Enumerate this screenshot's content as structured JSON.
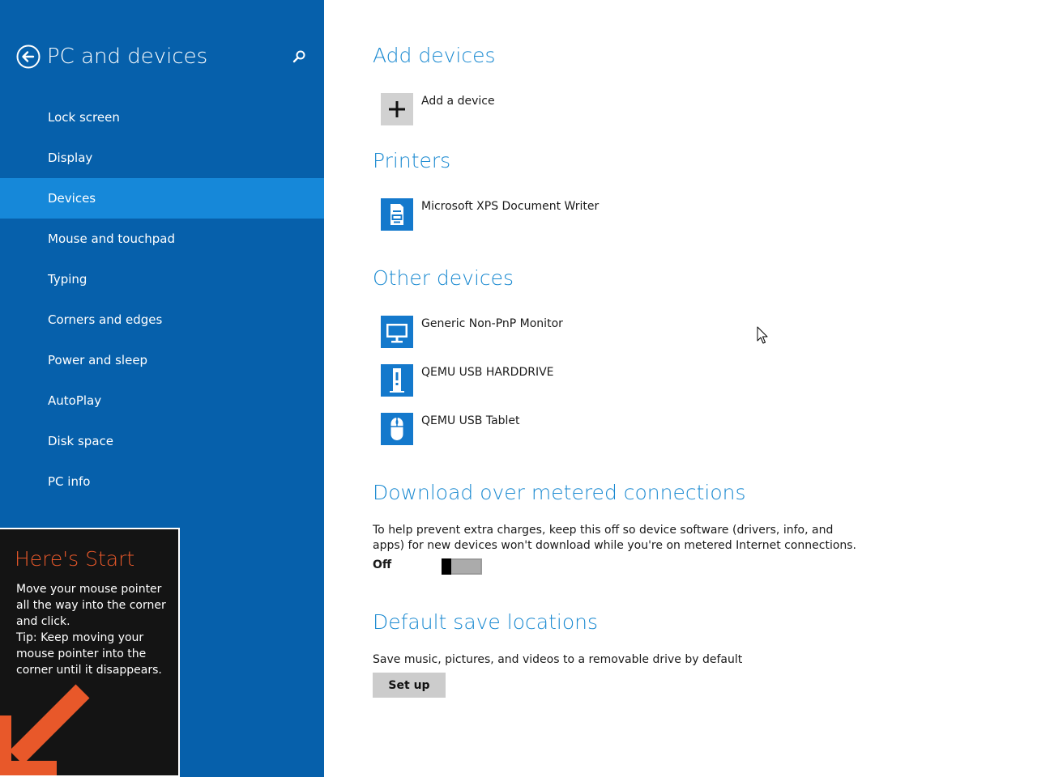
{
  "sidebar": {
    "title": "PC and devices",
    "items": [
      {
        "label": "Lock screen"
      },
      {
        "label": "Display"
      },
      {
        "label": "Devices",
        "selected": true
      },
      {
        "label": "Mouse and touchpad"
      },
      {
        "label": "Typing"
      },
      {
        "label": "Corners and edges"
      },
      {
        "label": "Power and sleep"
      },
      {
        "label": "AutoPlay"
      },
      {
        "label": "Disk space"
      },
      {
        "label": "PC info"
      }
    ]
  },
  "start_tip": {
    "title": "Here's Start",
    "body": "Move your mouse pointer all the way into the corner and click.\nTip: Keep moving your mouse pointer into the corner until it disappears."
  },
  "main": {
    "add_devices": {
      "title": "Add devices",
      "add_label": "Add a device",
      "icon": "plus-icon"
    },
    "printers": {
      "title": "Printers",
      "items": [
        {
          "label": "Microsoft XPS Document Writer",
          "icon": "printer-icon"
        }
      ]
    },
    "other_devices": {
      "title": "Other devices",
      "items": [
        {
          "label": "Generic Non-PnP Monitor",
          "icon": "monitor-icon"
        },
        {
          "label": "QEMU USB HARDDRIVE",
          "icon": "usb-drive-icon"
        },
        {
          "label": "QEMU USB Tablet",
          "icon": "mouse-icon"
        }
      ]
    },
    "metered": {
      "title": "Download over metered connections",
      "description": "To help prevent extra charges, keep this off so device software (drivers, info, and apps) for new devices won't download while you're on metered Internet connections.",
      "toggle_state": "Off",
      "toggle_on": false
    },
    "save_locations": {
      "title": "Default save locations",
      "description": "Save music, pictures, and videos to a removable drive by default",
      "button_label": "Set up"
    }
  },
  "colors": {
    "sidebar_bg": "#0660ab",
    "sidebar_selected": "#1688d9",
    "accent_title": "#1b8ad1",
    "device_tile": "#1479cc",
    "start_tip_title": "#e8582a"
  }
}
